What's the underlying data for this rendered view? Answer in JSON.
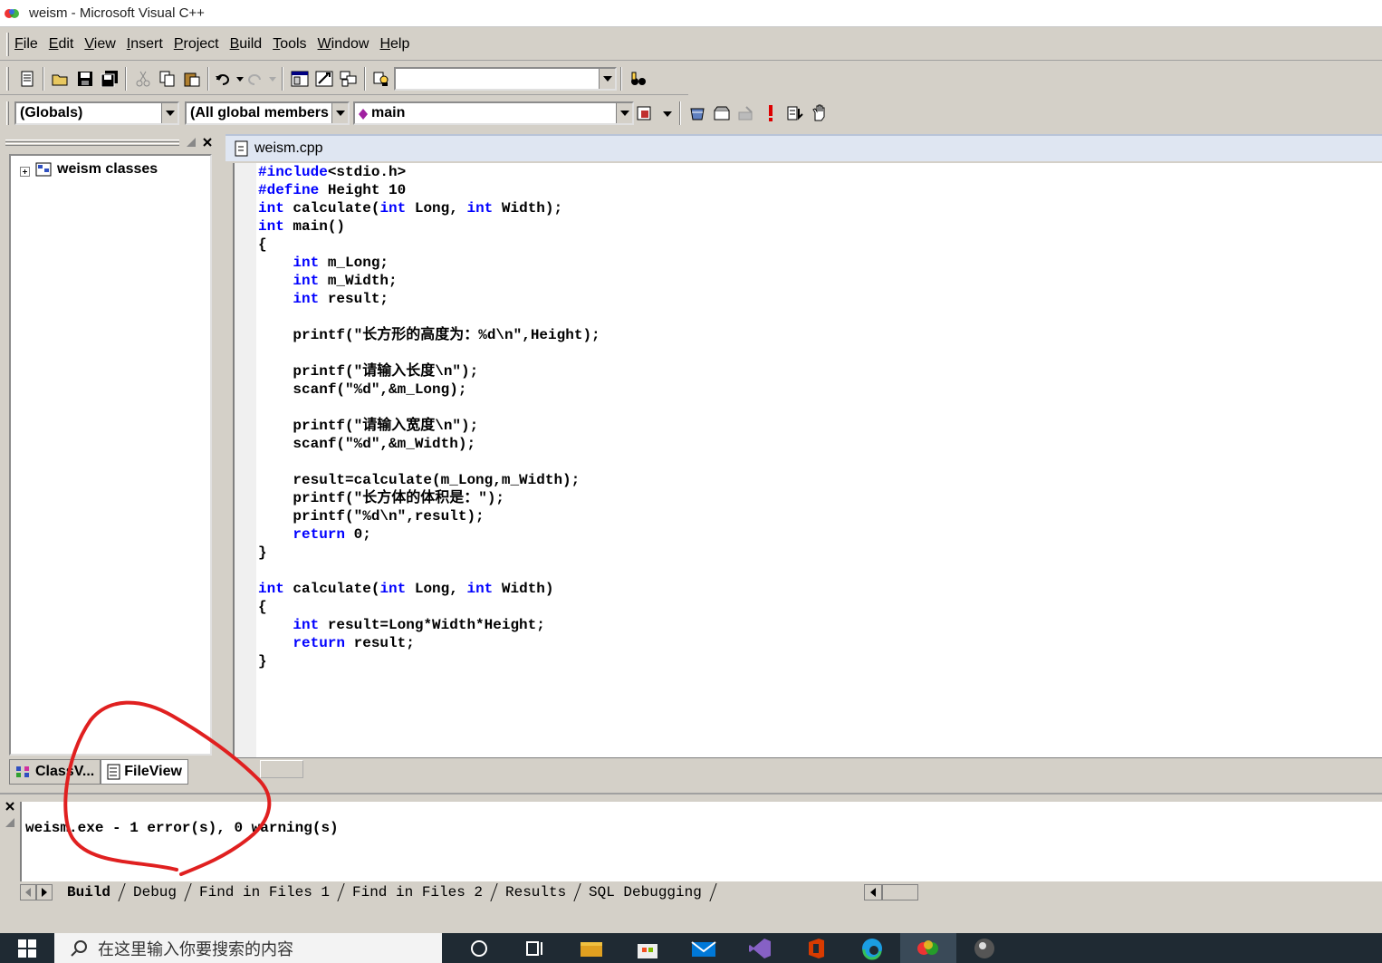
{
  "window": {
    "title": "weism - Microsoft Visual C++"
  },
  "menu": {
    "items": [
      {
        "label": "File",
        "key": "F",
        "rest": "ile"
      },
      {
        "label": "Edit",
        "key": "E",
        "rest": "dit"
      },
      {
        "label": "View",
        "key": "V",
        "rest": "iew"
      },
      {
        "label": "Insert",
        "key": "I",
        "rest": "nsert"
      },
      {
        "label": "Project",
        "key": "P",
        "rest": "roject"
      },
      {
        "label": "Build",
        "key": "B",
        "rest": "uild"
      },
      {
        "label": "Tools",
        "key": "T",
        "rest": "ools"
      },
      {
        "label": "Window",
        "key": "W",
        "rest": "indow"
      },
      {
        "label": "Help",
        "key": "H",
        "rest": "elp"
      }
    ]
  },
  "wizardbar": {
    "class_combo": "(Globals)",
    "filter_combo": "(All global members",
    "member_combo": "main"
  },
  "find_combo": {
    "value": ""
  },
  "workspace": {
    "root_label": "weism classes",
    "tab_classview": "ClassV...",
    "tab_fileview": "FileView"
  },
  "editor": {
    "file_title": "weism.cpp",
    "lines": [
      [
        {
          "t": "#include",
          "k": true
        },
        {
          "t": "<stdio.h>"
        }
      ],
      [
        {
          "t": "#define",
          "k": true
        },
        {
          "t": " Height 10"
        }
      ],
      [
        {
          "t": "int",
          "k": true
        },
        {
          "t": " calculate("
        },
        {
          "t": "int",
          "k": true
        },
        {
          "t": " Long, "
        },
        {
          "t": "int",
          "k": true
        },
        {
          "t": " Width);"
        }
      ],
      [
        {
          "t": "int",
          "k": true
        },
        {
          "t": " main()"
        }
      ],
      [
        {
          "t": "{"
        }
      ],
      [
        {
          "t": "    "
        },
        {
          "t": "int",
          "k": true
        },
        {
          "t": " m_Long;"
        }
      ],
      [
        {
          "t": "    "
        },
        {
          "t": "int",
          "k": true
        },
        {
          "t": " m_Width;"
        }
      ],
      [
        {
          "t": "    "
        },
        {
          "t": "int",
          "k": true
        },
        {
          "t": " result;"
        }
      ],
      [
        {
          "t": ""
        }
      ],
      [
        {
          "t": "    printf(\"长方形的高度为：%d\\n\",Height);"
        }
      ],
      [
        {
          "t": ""
        }
      ],
      [
        {
          "t": "    printf(\"请输入长度\\n\");"
        }
      ],
      [
        {
          "t": "    scanf(\"%d\",&m_Long);"
        }
      ],
      [
        {
          "t": ""
        }
      ],
      [
        {
          "t": "    printf(\"请输入宽度\\n\");"
        }
      ],
      [
        {
          "t": "    scanf(\"%d\",&m_Width);"
        }
      ],
      [
        {
          "t": ""
        }
      ],
      [
        {
          "t": "    result=calculate(m_Long,m_Width);"
        }
      ],
      [
        {
          "t": "    printf(\"长方体的体积是：\");"
        }
      ],
      [
        {
          "t": "    printf(\"%d\\n\",result);"
        }
      ],
      [
        {
          "t": "    "
        },
        {
          "t": "return",
          "k": true
        },
        {
          "t": " 0;"
        }
      ],
      [
        {
          "t": "}"
        }
      ],
      [
        {
          "t": ""
        }
      ],
      [
        {
          "t": "int",
          "k": true
        },
        {
          "t": " calculate("
        },
        {
          "t": "int",
          "k": true
        },
        {
          "t": " Long, "
        },
        {
          "t": "int",
          "k": true
        },
        {
          "t": " Width)"
        }
      ],
      [
        {
          "t": "{"
        }
      ],
      [
        {
          "t": "    "
        },
        {
          "t": "int",
          "k": true
        },
        {
          "t": " result=Long*Width*Height;"
        }
      ],
      [
        {
          "t": "    "
        },
        {
          "t": "return",
          "k": true
        },
        {
          "t": " result;"
        }
      ],
      [
        {
          "t": "}"
        }
      ]
    ]
  },
  "output": {
    "message": "weism.exe - 1 error(s), 0 warning(s)",
    "tabs": [
      "Build",
      "Debug",
      "Find in Files 1",
      "Find in Files 2",
      "Results",
      "SQL Debugging"
    ]
  },
  "taskbar": {
    "search_placeholder": "在这里输入你要搜索的内容",
    "icons": [
      "cortana-icon",
      "task-view-icon",
      "file-explorer-icon",
      "store-icon",
      "mail-icon",
      "visual-studio-icon",
      "office-icon",
      "edge-icon",
      "vc6-icon",
      "app-icon"
    ]
  },
  "colors": {
    "keyword": "#0000ff",
    "annotation": "#e02020",
    "chrome": "#d4d0c8"
  }
}
